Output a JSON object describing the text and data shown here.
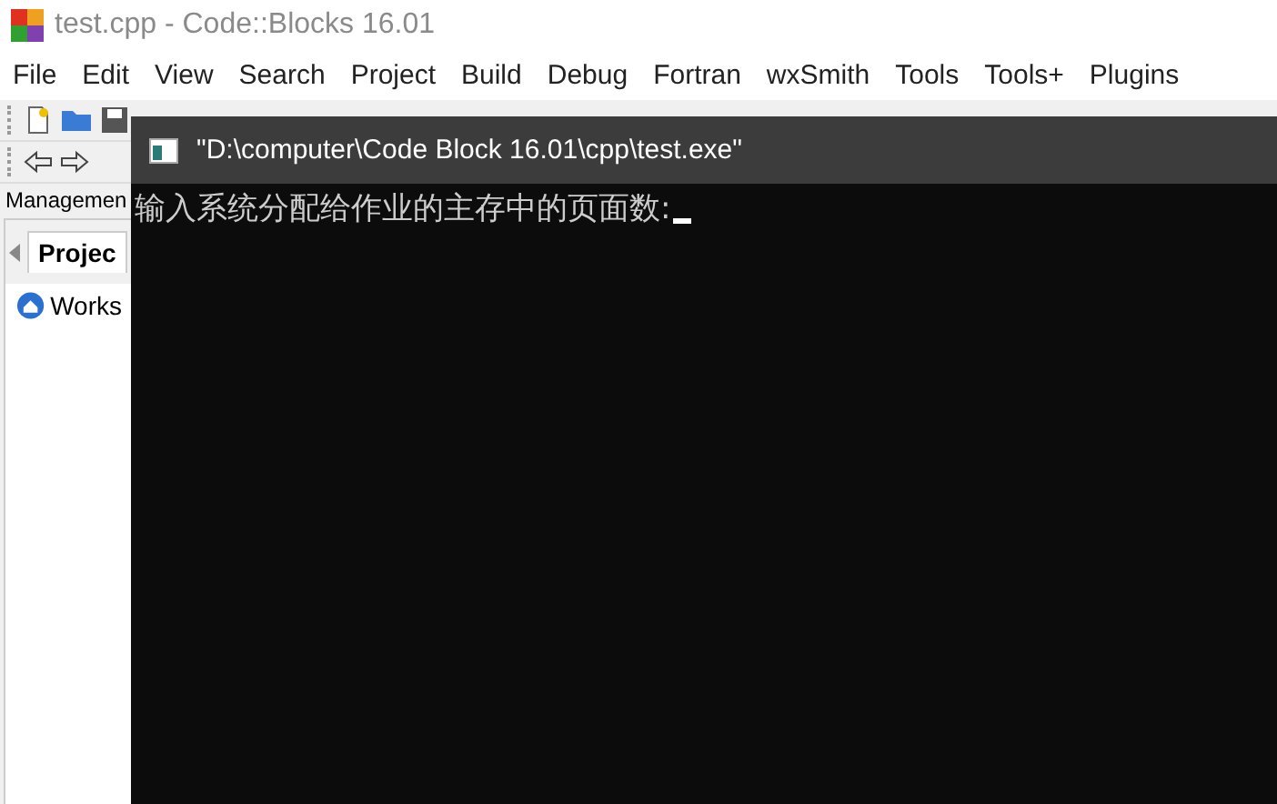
{
  "window": {
    "title": "test.cpp - Code::Blocks 16.01"
  },
  "menu": [
    "File",
    "Edit",
    "View",
    "Search",
    "Project",
    "Build",
    "Debug",
    "Fortran",
    "wxSmith",
    "Tools",
    "Tools+",
    "Plugins"
  ],
  "management": {
    "title": "Managemen",
    "tab": "Projec",
    "tree": [
      "Works"
    ]
  },
  "console": {
    "title": "\"D:\\computer\\Code Block 16.01\\cpp\\test.exe\"",
    "lines": [
      "输入系统分配给作业的主存中的页面数:"
    ],
    "cursor": true
  }
}
